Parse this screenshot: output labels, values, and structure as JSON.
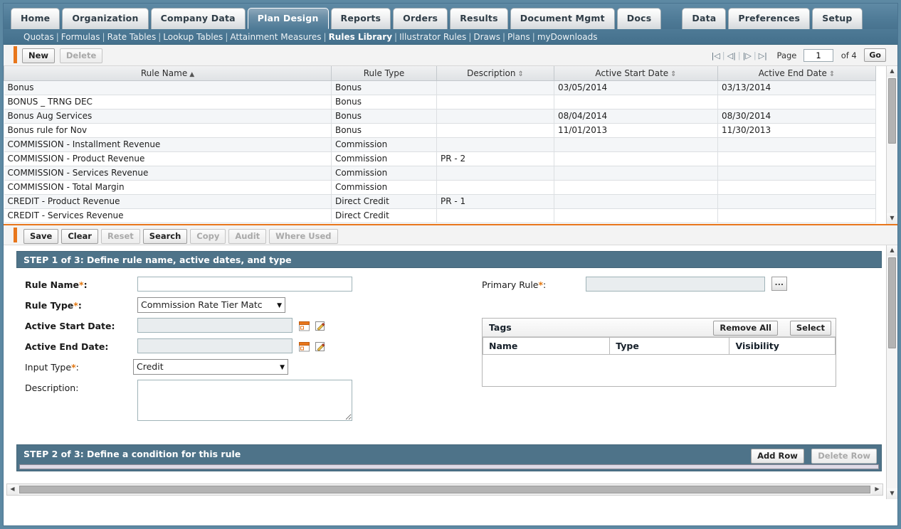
{
  "colors": {
    "frame_blue": "#5d89a3",
    "navbar_blue": "#4f7b97",
    "step_header_blue": "#4e7389",
    "accent_orange": "#e8761b",
    "required_star": "#e2760f"
  },
  "tabs": [
    {
      "label": "Home",
      "active": false,
      "gap": false
    },
    {
      "label": "Organization",
      "active": false,
      "gap": false
    },
    {
      "label": "Company Data",
      "active": false,
      "gap": false
    },
    {
      "label": "Plan Design",
      "active": true,
      "gap": false
    },
    {
      "label": "Reports",
      "active": false,
      "gap": false
    },
    {
      "label": "Orders",
      "active": false,
      "gap": false
    },
    {
      "label": "Results",
      "active": false,
      "gap": false
    },
    {
      "label": "Document Mgmt",
      "active": false,
      "gap": false
    },
    {
      "label": "Docs",
      "active": false,
      "gap": false
    },
    {
      "label": "Data",
      "active": false,
      "gap": true
    },
    {
      "label": "Preferences",
      "active": false,
      "gap": false
    },
    {
      "label": "Setup",
      "active": false,
      "gap": false
    }
  ],
  "subnav": {
    "items": [
      {
        "label": "Quotas",
        "current": false
      },
      {
        "label": "Formulas",
        "current": false
      },
      {
        "label": "Rate Tables",
        "current": false
      },
      {
        "label": "Lookup Tables",
        "current": false
      },
      {
        "label": "Attainment Measures",
        "current": false
      },
      {
        "label": "Rules Library",
        "current": true
      },
      {
        "label": "Illustrator Rules",
        "current": false
      },
      {
        "label": "Draws",
        "current": false
      },
      {
        "label": "Plans",
        "current": false
      },
      {
        "label": "myDownloads",
        "current": false
      }
    ],
    "separator": "|"
  },
  "list_toolbar": {
    "new_label": "New",
    "delete_label": "Delete",
    "new_disabled": false,
    "delete_disabled": true
  },
  "pager": {
    "first_icon": "|◁",
    "prev_icon": "◁|",
    "next_icon": "|▷",
    "last_icon": "▷|",
    "page_label": "Page",
    "page_value": "1",
    "of_label": "of 4",
    "go_label": "Go"
  },
  "grid": {
    "columns": [
      {
        "label": "Rule Name",
        "sort": "asc",
        "sort_glyph": "▲"
      },
      {
        "label": "Rule Type",
        "sort": "none",
        "sort_glyph": ""
      },
      {
        "label": "Description",
        "sort": "both",
        "sort_glyph": "⇕"
      },
      {
        "label": "Active Start Date",
        "sort": "both",
        "sort_glyph": "⇕"
      },
      {
        "label": "Active End Date",
        "sort": "both",
        "sort_glyph": "⇕"
      }
    ],
    "rows": [
      {
        "name": "Bonus",
        "type": "Bonus",
        "description": "",
        "start": "03/05/2014",
        "end": "03/13/2014"
      },
      {
        "name": "BONUS _ TRNG DEC",
        "type": "Bonus",
        "description": "",
        "start": "",
        "end": ""
      },
      {
        "name": "Bonus Aug Services",
        "type": "Bonus",
        "description": "",
        "start": "08/04/2014",
        "end": "08/30/2014"
      },
      {
        "name": "Bonus rule for Nov",
        "type": "Bonus",
        "description": "",
        "start": "11/01/2013",
        "end": "11/30/2013"
      },
      {
        "name": "COMMISSION - Installment Revenue",
        "type": "Commission",
        "description": "",
        "start": "",
        "end": ""
      },
      {
        "name": "COMMISSION - Product Revenue",
        "type": "Commission",
        "description": "PR - 2",
        "start": "",
        "end": ""
      },
      {
        "name": "COMMISSION - Services Revenue",
        "type": "Commission",
        "description": "",
        "start": "",
        "end": ""
      },
      {
        "name": "COMMISSION - Total Margin",
        "type": "Commission",
        "description": "",
        "start": "",
        "end": ""
      },
      {
        "name": "CREDIT - Product Revenue",
        "type": "Direct Credit",
        "description": "PR - 1",
        "start": "",
        "end": ""
      },
      {
        "name": "CREDIT - Services Revenue",
        "type": "Direct Credit",
        "description": "",
        "start": "",
        "end": ""
      }
    ]
  },
  "form_toolbar": {
    "buttons": [
      {
        "label": "Save",
        "disabled": false
      },
      {
        "label": "Clear",
        "disabled": false
      },
      {
        "label": "Reset",
        "disabled": true
      },
      {
        "label": "Search",
        "disabled": false
      },
      {
        "label": "Copy",
        "disabled": true
      },
      {
        "label": "Audit",
        "disabled": true
      },
      {
        "label": "Where Used",
        "disabled": true
      }
    ]
  },
  "step1": {
    "header": "STEP 1 of 3: Define rule name, active dates, and type",
    "rule_name_label": "Rule Name",
    "rule_name_value": "",
    "rule_type_label": "Rule Type",
    "rule_type_value": "Commission Rate Tier Matc",
    "active_start_label": "Active Start Date:",
    "active_start_value": "",
    "active_end_label": "Active End Date:",
    "active_end_value": "",
    "input_type_label": "Input Type",
    "input_type_value": "Credit",
    "description_label": "Description:",
    "description_value": "",
    "required_marker": "*",
    "colon": ":"
  },
  "step1_right": {
    "primary_rule_label": "Primary Rule",
    "primary_rule_value": "",
    "browse_label": "...",
    "tags_title": "Tags",
    "remove_all_label": "Remove All",
    "select_label": "Select",
    "tag_columns": [
      "Name",
      "Type",
      "Visibility"
    ],
    "tag_rows": []
  },
  "step2": {
    "header": "STEP 2 of 3: Define a condition for this rule",
    "add_row_label": "Add Row",
    "delete_row_label": "Delete Row",
    "add_row_disabled": false,
    "delete_row_disabled": true
  },
  "scrollbars": {
    "up_glyph": "▲",
    "down_glyph": "▼",
    "left_glyph": "◀",
    "right_glyph": "▶"
  }
}
